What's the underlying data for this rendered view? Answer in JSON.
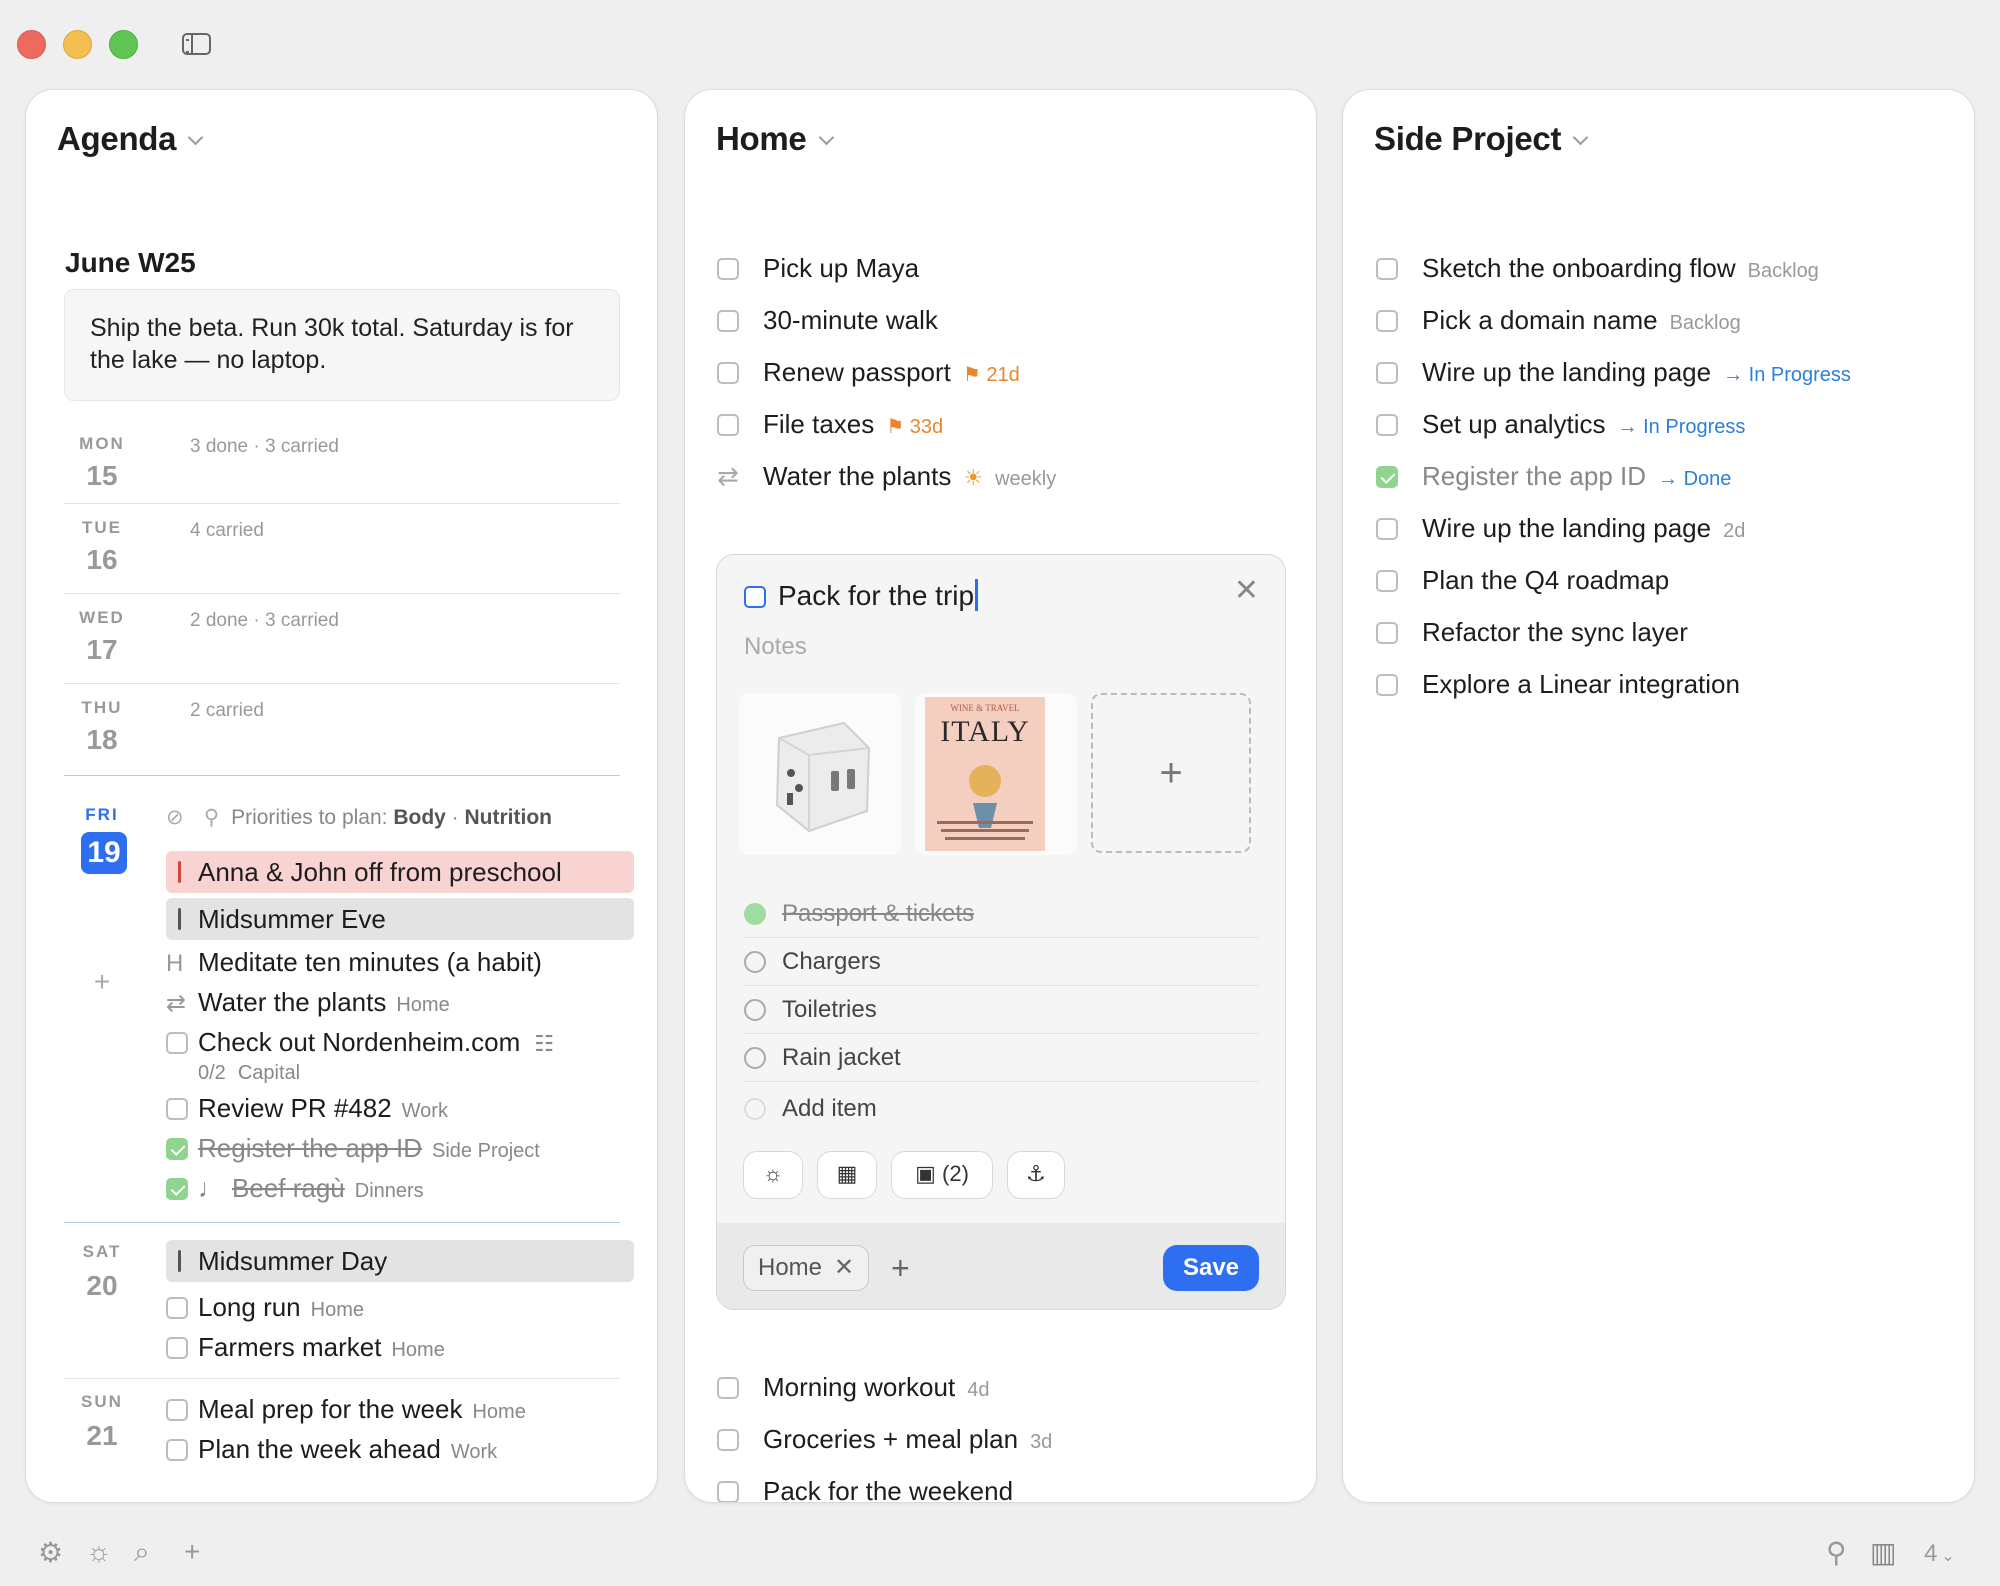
{
  "agenda": {
    "title": "Agenda",
    "week_title": "June W25",
    "goal_text": "Ship the beta. Run 30k total. Saturday is for the lake — no laptop.",
    "days": [
      {
        "name": "MON",
        "num": "15",
        "summary": "3 done · 3 carried"
      },
      {
        "name": "TUE",
        "num": "16",
        "summary": "4 carried"
      },
      {
        "name": "WED",
        "num": "17",
        "summary": "2 done · 3 carried"
      },
      {
        "name": "THU",
        "num": "18",
        "summary": "2 carried"
      }
    ],
    "today": {
      "name": "FRI",
      "num": "19",
      "priorities_label": "Priorities to plan:",
      "priority_1": "Body",
      "priority_2": "Nutrition",
      "event_1": "Anna & John off from preschool",
      "event_2": "Midsummer Eve",
      "habit": "Meditate ten minutes (a habit)",
      "water": "Water the plants",
      "water_tag": "Home",
      "nord": "Check out Nordenheim.com",
      "nord_sub": "0/2",
      "nord_tag": "Capital",
      "pr": "Review PR #482",
      "pr_tag": "Work",
      "appid": "Register the app ID",
      "appid_tag": "Side Project",
      "beef": "Beef ragù",
      "beef_tag": "Dinners"
    },
    "sat": {
      "name": "SAT",
      "num": "20",
      "event": "Midsummer Day",
      "run": "Long run",
      "run_tag": "Home",
      "market": "Farmers market",
      "market_tag": "Home"
    },
    "sun": {
      "name": "SUN",
      "num": "21",
      "meal": "Meal prep for the week",
      "meal_tag": "Home",
      "plan": "Plan the week ahead",
      "plan_tag": "Work"
    }
  },
  "home": {
    "title": "Home",
    "items": [
      {
        "label": "Pick up Maya"
      },
      {
        "label": "30-minute walk"
      },
      {
        "label": "Renew passport",
        "due": "21d"
      },
      {
        "label": "File taxes",
        "due": "33d"
      },
      {
        "label": "Water the plants",
        "repeat": "weekly"
      }
    ],
    "editor": {
      "title": "Pack for the trip",
      "notes_placeholder": "Notes",
      "thumb_text": "ITALY",
      "thumb_kicker": "WINE & TRAVEL",
      "subtasks": [
        {
          "label": "Passport & tickets",
          "done": true
        },
        {
          "label": "Chargers"
        },
        {
          "label": "Toiletries"
        },
        {
          "label": "Rain jacket"
        }
      ],
      "add_item_placeholder": "Add item",
      "image_count": "(2)",
      "tag": "Home",
      "save_label": "Save"
    },
    "later_items": [
      {
        "label": "Morning workout",
        "meta": "4d"
      },
      {
        "label": "Groceries + meal plan",
        "meta": "3d"
      },
      {
        "label": "Pack for the weekend"
      }
    ]
  },
  "side": {
    "title": "Side Project",
    "items": [
      {
        "label": "Sketch the onboarding flow",
        "status": "Backlog"
      },
      {
        "label": "Pick a domain name",
        "status": "Backlog"
      },
      {
        "label": "Wire up the landing page",
        "status": "→ In Progress"
      },
      {
        "label": "Set up analytics",
        "status": "→ In Progress"
      },
      {
        "label": "Register the app ID",
        "status": "→ Done"
      },
      {
        "label": "Wire up the landing page",
        "meta": "2d"
      },
      {
        "label": "Plan the Q4 roadmap"
      },
      {
        "label": "Refactor the sync layer"
      },
      {
        "label": "Explore a Linear integration"
      }
    ]
  },
  "bottombar": {
    "column_count": "4"
  },
  "colors": {
    "accent": "#2d6ff0",
    "event_red": "#f9d3d1",
    "done_green": "#8fd48f",
    "due_orange": "#e8872a"
  }
}
